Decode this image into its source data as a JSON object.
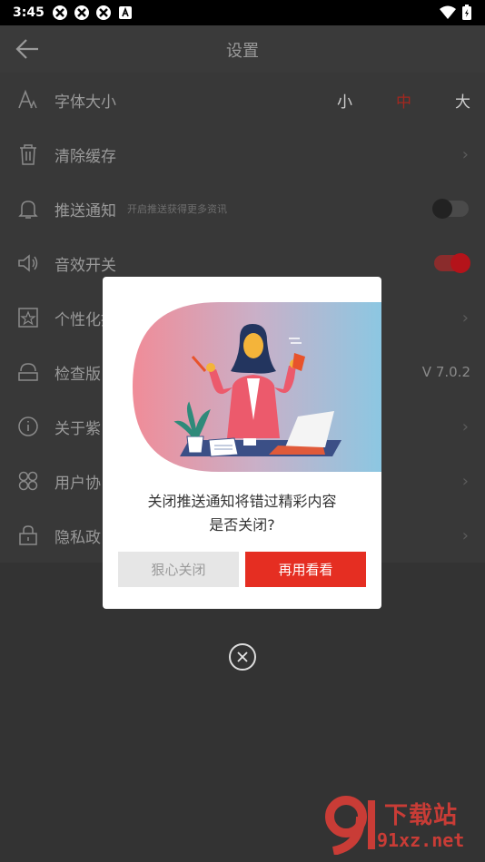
{
  "status_bar": {
    "time": "3:45"
  },
  "header": {
    "title": "设置"
  },
  "settings": {
    "font_size": {
      "label": "字体大小",
      "options": [
        "小",
        "中",
        "大"
      ]
    },
    "clear_cache": {
      "label": "清除缓存"
    },
    "push": {
      "label": "推送通知",
      "sub": "开启推送获得更多资讯"
    },
    "sound": {
      "label": "音效开关"
    },
    "personalize": {
      "label": "个性化推"
    },
    "check_version": {
      "label": "检查版",
      "value": "V 7.0.2"
    },
    "about": {
      "label": "关于紫"
    },
    "user_agreement": {
      "label": "用户协"
    },
    "privacy": {
      "label": "隐私政"
    }
  },
  "dialog": {
    "message_line1": "关闭推送通知将错过精彩内容",
    "message_line2": "是否关闭?",
    "cancel_label": "狠心关闭",
    "confirm_label": "再用看看"
  },
  "watermark": {
    "brand": "下载站",
    "url": "91xz.net"
  },
  "colors": {
    "accent": "#e52e22",
    "toggle_on": "#b4131a",
    "overlay": "#333333"
  }
}
